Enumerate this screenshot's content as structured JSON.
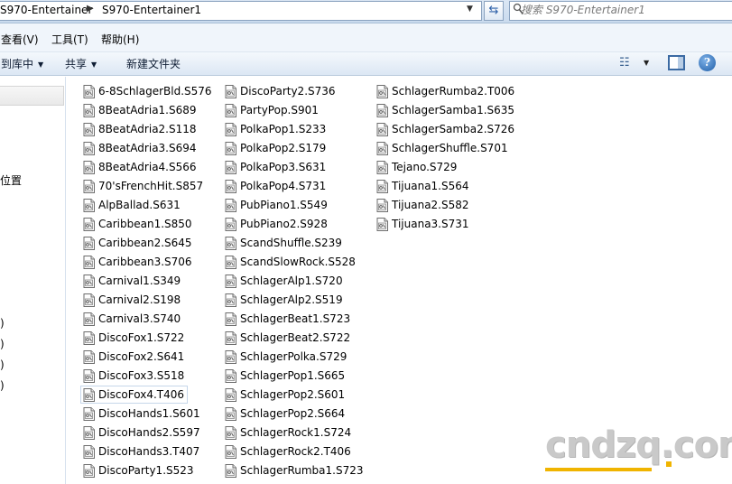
{
  "address": {
    "crumb1": "S970-Entertainer",
    "crumb2": "S970-Entertainer1",
    "search_placeholder": "搜索 S970-Entertainer1"
  },
  "menu": {
    "items": [
      "查看(V)",
      "工具(T)",
      "帮助(H)"
    ]
  },
  "commands": {
    "include_in_library": "到库中",
    "share": "共享",
    "new_folder": "新建文件夹"
  },
  "nav": {
    "partial_label": "位置",
    "partial_fragments": [
      ")",
      ")",
      ")",
      ")"
    ]
  },
  "files": {
    "column1": [
      "6-8SchlagerBld.S576",
      "8BeatAdria1.S689",
      "8BeatAdria2.S118",
      "8BeatAdria3.S694",
      "8BeatAdria4.S566",
      "70'sFrenchHit.S857",
      "AlpBallad.S631",
      "Caribbean1.S850",
      "Caribbean2.S645",
      "Caribbean3.S706",
      "Carnival1.S349",
      "Carnival2.S198",
      "Carnival3.S740",
      "DiscoFox1.S722",
      "DiscoFox2.S641",
      "DiscoFox3.S518",
      "DiscoFox4.T406",
      "DiscoHands1.S601",
      "DiscoHands2.S597",
      "DiscoHands3.T407",
      "DiscoParty1.S523"
    ],
    "column2": [
      "DiscoParty2.S736",
      "PartyPop.S901",
      "PolkaPop1.S233",
      "PolkaPop2.S179",
      "PolkaPop3.S631",
      "PolkaPop4.S731",
      "PubPiano1.S549",
      "PubPiano2.S928",
      "ScandShuffle.S239",
      "ScandSlowRock.S528",
      "SchlagerAlp1.S720",
      "SchlagerAlp2.S519",
      "SchlagerBeat1.S723",
      "SchlagerBeat2.S722",
      "SchlagerPolka.S729",
      "SchlagerPop1.S665",
      "SchlagerPop2.S601",
      "SchlagerPop2.S664",
      "SchlagerRock1.S724",
      "SchlagerRock2.T406",
      "SchlagerRumba1.S723"
    ],
    "column3": [
      "SchlagerRumba2.T006",
      "SchlagerSamba1.S635",
      "SchlagerSamba2.S726",
      "SchlagerShuffle.S701",
      "Tejano.S729",
      "Tijuana1.S564",
      "Tijuana2.S582",
      "Tijuana3.S731"
    ],
    "focused_item": "DiscoFox4.T406"
  },
  "watermark": {
    "text": "cndzq.com"
  },
  "colors": {
    "accent": "#f0b400",
    "chrome": "#dce7f4"
  }
}
